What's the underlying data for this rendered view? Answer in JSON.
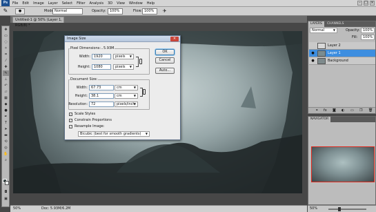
{
  "menubar": {
    "logo": "Ps",
    "items": [
      "File",
      "Edit",
      "Image",
      "Layer",
      "Select",
      "Filter",
      "Analysis",
      "3D",
      "View",
      "Window",
      "Help"
    ],
    "window_controls": [
      "–",
      "□",
      "×"
    ]
  },
  "options_bar": {
    "mode_label": "Mode:",
    "mode_value": "Normal",
    "opacity_label": "Opacity:",
    "opacity_value": "100%",
    "flow_label": "Flow:",
    "flow_value": "100%"
  },
  "document": {
    "tab_title": "Untitled-1 @ 50% (Layer 1, RGB/8) *",
    "zoom": "50%",
    "doc_size": "Doc: 5.93M/6.2M"
  },
  "dialog": {
    "title": "Image Size",
    "close": "×",
    "pixel_dimensions_label": "Pixel Dimensions:",
    "pixel_dimensions_value": "5.93M",
    "width_label": "Width:",
    "width_value": "1920",
    "width_unit": "pixels",
    "height_label": "Height:",
    "height_value": "1080",
    "height_unit": "pixels",
    "document_size_label": "Document Size:",
    "doc_width_value": "67.73",
    "doc_width_unit": "cm",
    "doc_height_value": "38.1",
    "doc_height_unit": "cm",
    "resolution_label": "Resolution:",
    "resolution_value": "72",
    "resolution_unit": "pixels/inch",
    "scale_styles": "Scale Styles",
    "constrain_proportions": "Constrain Proportions",
    "resample_image": "Resample Image:",
    "resample_method": "Bicubic (best for smooth gradients)",
    "ok": "OK",
    "cancel": "Cancel",
    "auto": "Auto..."
  },
  "layers_panel": {
    "tab_layers": "LAYERS",
    "tab_channels": "CHANNELS",
    "blend_mode": "Normal",
    "opacity_label": "Opacity:",
    "opacity_value": "100%",
    "fill_label": "Fill:",
    "fill_value": "100%",
    "layers": [
      {
        "name": "Layer 2",
        "selected": false
      },
      {
        "name": "Layer 1",
        "selected": true
      },
      {
        "name": "Background",
        "selected": false
      }
    ]
  },
  "navigator": {
    "tab": "NAVIGATOR",
    "zoom": "50%"
  },
  "colors": {
    "selected_layer": "#3d8ee0",
    "nav_frame": "#e0291d",
    "dialog_title": "#c3d3e8"
  }
}
